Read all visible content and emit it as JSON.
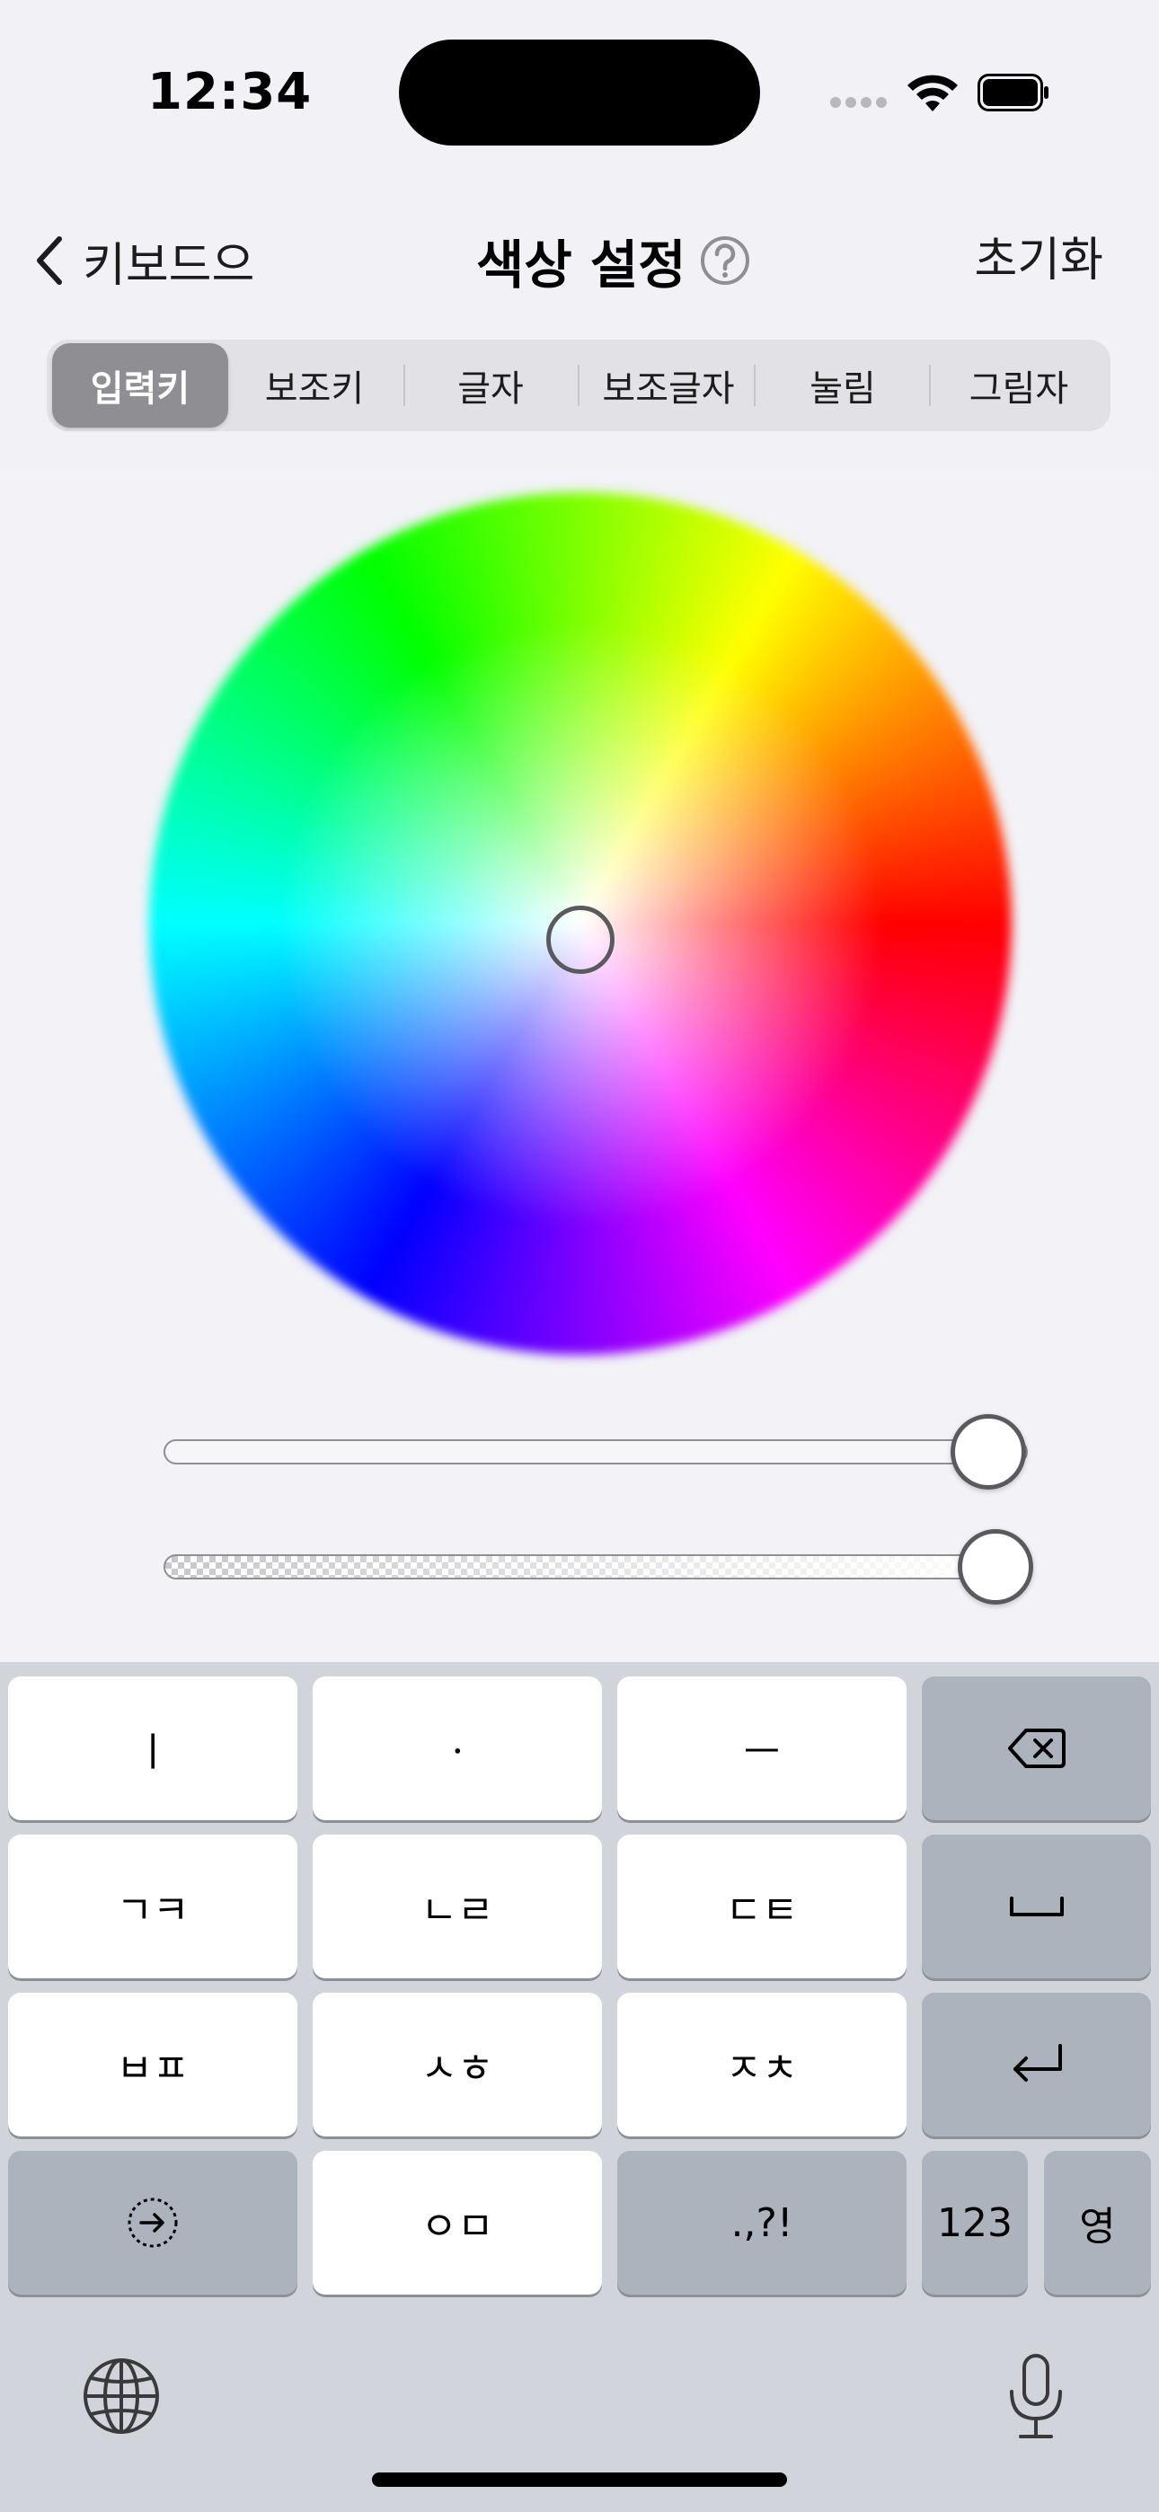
{
  "status_bar": {
    "time": "12:34",
    "icons": [
      "signal-icon",
      "wifi-icon",
      "battery-icon"
    ]
  },
  "nav": {
    "back_label": "키보드으",
    "title": "색상 설정",
    "reset_label": "초기화",
    "icons": [
      "chevron-left-icon",
      "help-icon"
    ]
  },
  "tabs": [
    {
      "label": "입력키",
      "active": true
    },
    {
      "label": "보조키",
      "active": false
    },
    {
      "label": "글자",
      "active": false
    },
    {
      "label": "보조글자",
      "active": false
    },
    {
      "label": "눌림",
      "active": false
    },
    {
      "label": "그림자",
      "active": false
    }
  ],
  "picker": {
    "brightness_level": 1.0,
    "opacity_level": 1.0,
    "selected_hue_position": "center"
  },
  "keyboard": {
    "rows": [
      [
        "ㅣ",
        "ㆍ",
        "ㅡ",
        "backspace-icon"
      ],
      [
        "ㄱㅋ",
        "ㄴㄹ",
        "ㄷㅌ",
        "space-icon"
      ],
      [
        "ㅂㅍ",
        "ㅅㅎ",
        "ㅈㅊ",
        "return-icon"
      ],
      [
        "next-field-icon",
        "ㅇㅁ",
        ".,?!",
        "123",
        "영"
      ]
    ],
    "bottom_icons": [
      "globe-icon",
      "microphone-icon"
    ]
  },
  "colors": {
    "accent_selected_tab": "#8e8e93",
    "keyboard_background": "#d1d4da",
    "function_key": "#adb3bd"
  }
}
